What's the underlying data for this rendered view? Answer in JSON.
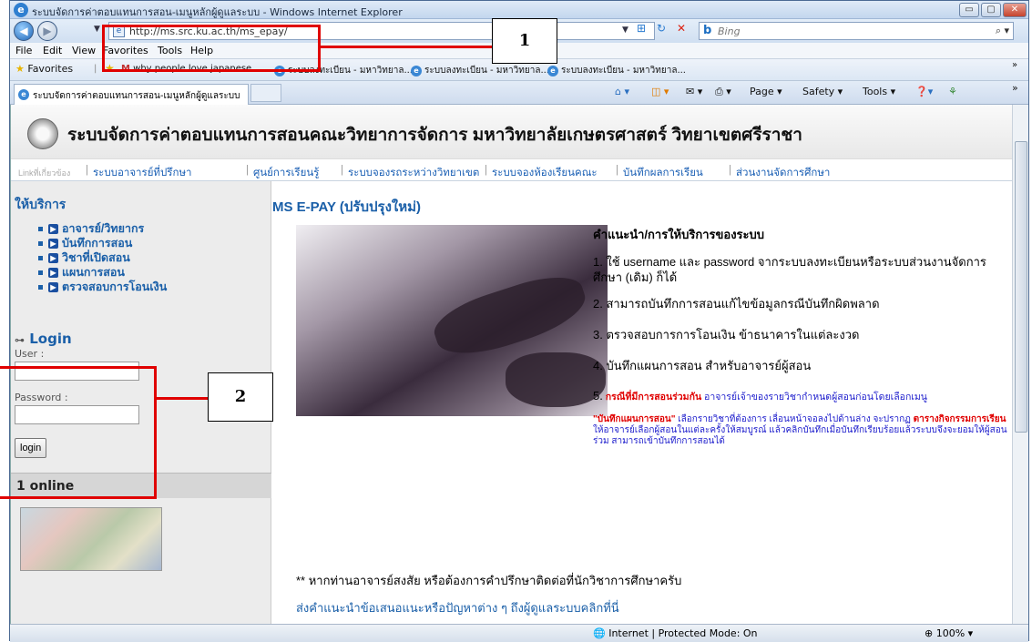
{
  "window": {
    "title": "ระบบจัดการค่าตอบแทนการสอน-เมนูหลักผู้ดูแลระบบ - Windows Internet Explorer",
    "buttons": {
      "minimize": "▭",
      "maximize": "▢",
      "close": "✕"
    }
  },
  "address_bar": {
    "url": "http://ms.src.ku.ac.th/ms_epay/",
    "search_placeholder": "Bing"
  },
  "menu": {
    "items": [
      "File",
      "Edit",
      "View",
      "Favorites",
      "Tools",
      "Help"
    ]
  },
  "favorites_bar": {
    "label": "Favorites",
    "items": [
      "why people love japanese ...",
      "ระบบลงทะเบียน - มหาวิทยาล...",
      "ระบบลงทะเบียน - มหาวิทยาล...",
      "ระบบลงทะเบียน - มหาวิทยาล..."
    ]
  },
  "tab": {
    "label": "ระบบจัดการค่าตอบแทนการสอน-เมนูหลักผู้ดูแลระบบ"
  },
  "command_bar": {
    "page": "Page",
    "safety": "Safety",
    "tools": "Tools"
  },
  "page": {
    "site_title": "ระบบจัดการค่าตอบแทนการสอนคณะวิทยาการจัดการ มหาวิทยาลัยเกษตรศาสตร์ วิทยาเขตศรีราชา",
    "links_label": "Linkที่เกี่ยวข้อง",
    "links": [
      "ระบบอาจารย์ที่ปรึกษา",
      "ศูนย์การเรียนรู้",
      "ระบบจองรถระหว่างวิทยาเขต",
      "ระบบจองห้องเรียนคณะ",
      "บันทึกผลการเรียน",
      "ส่วนงานจัดการศึกษา"
    ],
    "sidebar": {
      "services_heading": "ให้บริการ",
      "services": [
        "อาจารย์/วิทยากร",
        "บันทึกการสอน",
        "วิชาที่เปิดสอน",
        "แผนการสอน",
        "ตรวจสอบการโอนเงิน"
      ],
      "login_heading": "Login",
      "user_label": "User :",
      "password_label": "Password :",
      "login_button": "login",
      "online": "1 online"
    },
    "main": {
      "title": "MS E-PAY (ปรับปรุงใหม่)",
      "guide_heading": "คำแนะนำ/การให้บริการของระบบ",
      "guide_1": "1. ใช้ username และ password จากระบบลงทะเบียนหรือระบบส่วนงานจัดการศึกษา (เดิม) ก็ได้",
      "guide_2": "2. สามารถบันทึกการสอนแก้ไขข้อมูลกรณีบันทึกผิดพลาด",
      "guide_3": "3. ตรวจสอบการการโอนเงิน ข้าธนาคารในแต่ละงวด",
      "guide_4": "4. บันทึกแผนการสอน สำหรับอาจารย์ผู้สอน",
      "guide_5_num": "5.",
      "guide_5_red": "กรณีที่มีการสอนร่วมกัน",
      "guide_5_text": "อาจารย์เจ้าของรายวิชากำหนดผู้สอนก่อนโดยเลือกเมนู",
      "guide_5_red2": "\"บันทึกแผนการสอน\"",
      "guide_5_text2": "เลือกรายวิชาที่ต้องการ เลื่อนหน้าจอลงไปด้านล่าง จะปรากฏ",
      "guide_5_red3": "ตารางกิจกรรมการเรียน",
      "guide_5_text3": "ให้อาจารย์เลือกผู้สอนในแต่ละครั้งให้สมบูรณ์ แล้วคลิกบันทึกเมื่อบันทึกเรียบร้อยแล้วระบบจึงจะยอมให้ผู้สอนร่วม สามารถเข้าบันทึกการสอนได้",
      "note": "** หากท่านอาจารย์สงสัย หรือต้องการคำปรึกษาติดต่อที่นักวิชาการศึกษาครับ",
      "contact_link": "ส่งคำแนะนำข้อเสนอแนะหรือปัญหาต่าง ๆ ถึงผู้ดูแลระบบคลิกที่นี่"
    }
  },
  "status_bar": {
    "zone": "Internet | Protected Mode: On",
    "zoom": "100%"
  },
  "annotations": {
    "callout_1": "1",
    "callout_2": "2",
    "color": "#e00000"
  }
}
